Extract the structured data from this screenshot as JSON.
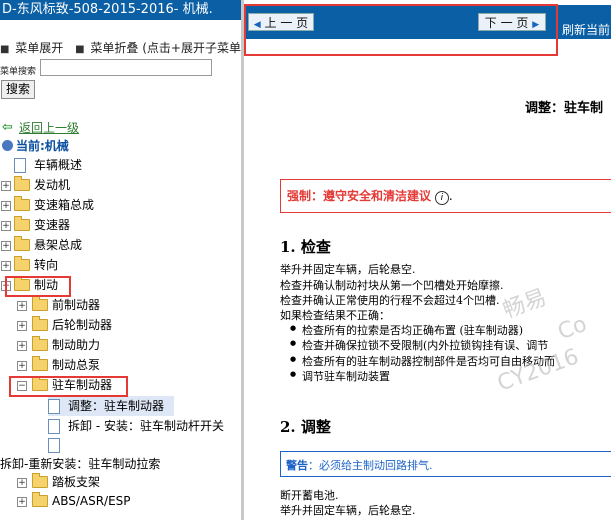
{
  "left_panel": {
    "title": "D-东风标致-508-2015-2016- 机械.",
    "menu": {
      "expand": "菜单展开",
      "collapse": "菜单折叠 (点击+展开子菜单)"
    },
    "search": {
      "label": "菜单搜索",
      "value": "",
      "button": "搜索"
    },
    "back_link": "返回上一级",
    "current": "当前:机械",
    "tree": [
      "车辆概述",
      "发动机",
      "变速箱总成",
      "变速器",
      "悬架总成",
      "转向",
      "制动",
      "前制动器",
      "后轮制动器",
      "制动助力",
      "制动总泵",
      "驻车制动器",
      "调整：驻车制动器",
      "拆卸 - 安装：驻车制动杆开关",
      "拆卸-重新安装：驻车制动拉索",
      "踏板支架",
      "ABS/ASR/ESP"
    ]
  },
  "right_panel": {
    "prev_label": "上 一 页",
    "next_label": "下 一 页",
    "refresh_text": "刷新当前",
    "main_heading": "调整：驻车制",
    "warning": {
      "key": "强制",
      "text": "：遵守安全和清洁建议",
      "icon": "i",
      "tail": "."
    },
    "section1_title": "1. 检查",
    "section1_lines": [
      "举升并固定车辆，后轮悬空.",
      "检查并确认制动衬块从第一个凹槽处开始摩擦.",
      "检查并确认正常使用的行程不会超过4个凹槽.",
      "如果检查结果不正确："
    ],
    "section1_bullets": [
      "检查所有的拉索是否均正确布置 (驻车制动器)",
      "检查并确保拉锁不受限制(内外拉锁钩挂有误、调节",
      "检查所有的驻车制动器控制部件是否均可自由移动而",
      "调节驻车制动装置"
    ],
    "section2_title": "2. 调整",
    "note": {
      "key": "警告",
      "text": "：必须给主制动回路排气."
    },
    "section2_lines": [
      "断开蓄电池.",
      "举升并固定车辆，后轮悬空."
    ],
    "watermark_lines": [
      "畅易",
      "Co",
      "CY2016"
    ]
  },
  "colors": {
    "accent": "#0b5fa5",
    "highlight": "#e53935",
    "note": "#1e63c8",
    "link": "#2e7d32"
  }
}
